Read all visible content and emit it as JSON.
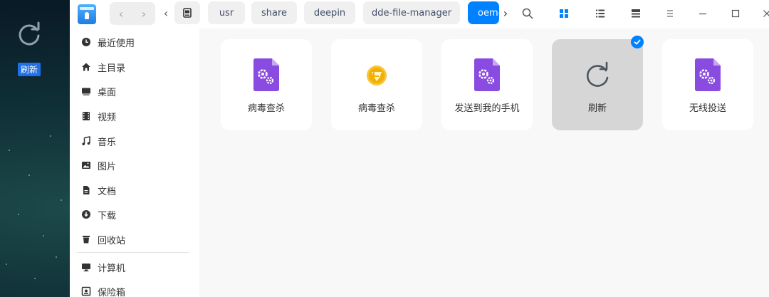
{
  "desktop": {
    "icon_label": "刷新"
  },
  "titlebar": {
    "breadcrumbs": [
      "usr",
      "share",
      "deepin",
      "dde-file-manager",
      "oem-menuextensions"
    ],
    "icons": {
      "back": "chevron-left-icon",
      "forward": "chevron-right-icon",
      "search": "search-icon",
      "icon_view": "grid-view-icon",
      "list_view": "list-view-icon",
      "detail": "detail-view-icon",
      "menu": "menu-icon",
      "minimize": "minimize-icon",
      "maximize": "maximize-icon",
      "close": "close-icon"
    }
  },
  "sidebar": {
    "items": [
      {
        "label": "最近使用",
        "icon": "clock-icon"
      },
      {
        "label": "主目录",
        "icon": "home-icon"
      },
      {
        "label": "桌面",
        "icon": "desktop-icon"
      },
      {
        "label": "视频",
        "icon": "video-icon"
      },
      {
        "label": "音乐",
        "icon": "music-icon"
      },
      {
        "label": "图片",
        "icon": "picture-icon"
      },
      {
        "label": "文档",
        "icon": "document-icon"
      },
      {
        "label": "下载",
        "icon": "download-icon"
      },
      {
        "label": "回收站",
        "icon": "trash-icon"
      },
      {
        "label": "计算机",
        "icon": "computer-icon"
      },
      {
        "label": "保险箱",
        "icon": "vault-icon"
      }
    ]
  },
  "files": [
    {
      "name": "病毒查杀",
      "icon": "gear-file-icon",
      "selected": false
    },
    {
      "name": "病毒查杀",
      "icon": "shield-icon",
      "selected": false
    },
    {
      "name": "发送到我的手机",
      "icon": "gear-file-icon",
      "selected": false
    },
    {
      "name": "刷新",
      "icon": "refresh-icon",
      "selected": true
    },
    {
      "name": "无线投送",
      "icon": "gear-file-icon",
      "selected": false
    }
  ],
  "colors": {
    "accent": "#0081ff",
    "selected_tile": "#d6d6d6",
    "file_icon_purple": "#8a4ce0"
  }
}
